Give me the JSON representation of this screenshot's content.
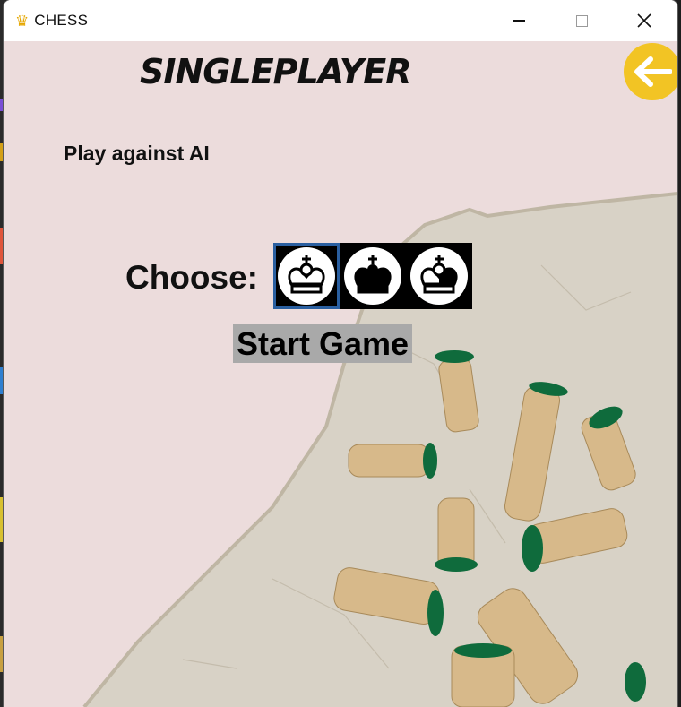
{
  "window": {
    "title": "CHESS",
    "app_icon": "crown-icon",
    "controls": [
      "minimize-icon",
      "maximize-icon",
      "close-icon"
    ]
  },
  "screen": {
    "heading": "SINGLEPLAYER",
    "subtitle": "Play against AI",
    "choose_label": "Choose:",
    "side_options": [
      {
        "icon": "white-king-icon",
        "selected": true
      },
      {
        "icon": "black-king-icon",
        "selected": false
      },
      {
        "icon": "random-king-icon",
        "selected": false
      }
    ],
    "start_button": "Start Game",
    "back_button_icon": "arrow-left-icon"
  },
  "colors": {
    "background": "#ecdcdc",
    "back_button": "#f2c424",
    "start_button_bg": "#a9a9a9",
    "selected_border": "#2a5fa0"
  }
}
